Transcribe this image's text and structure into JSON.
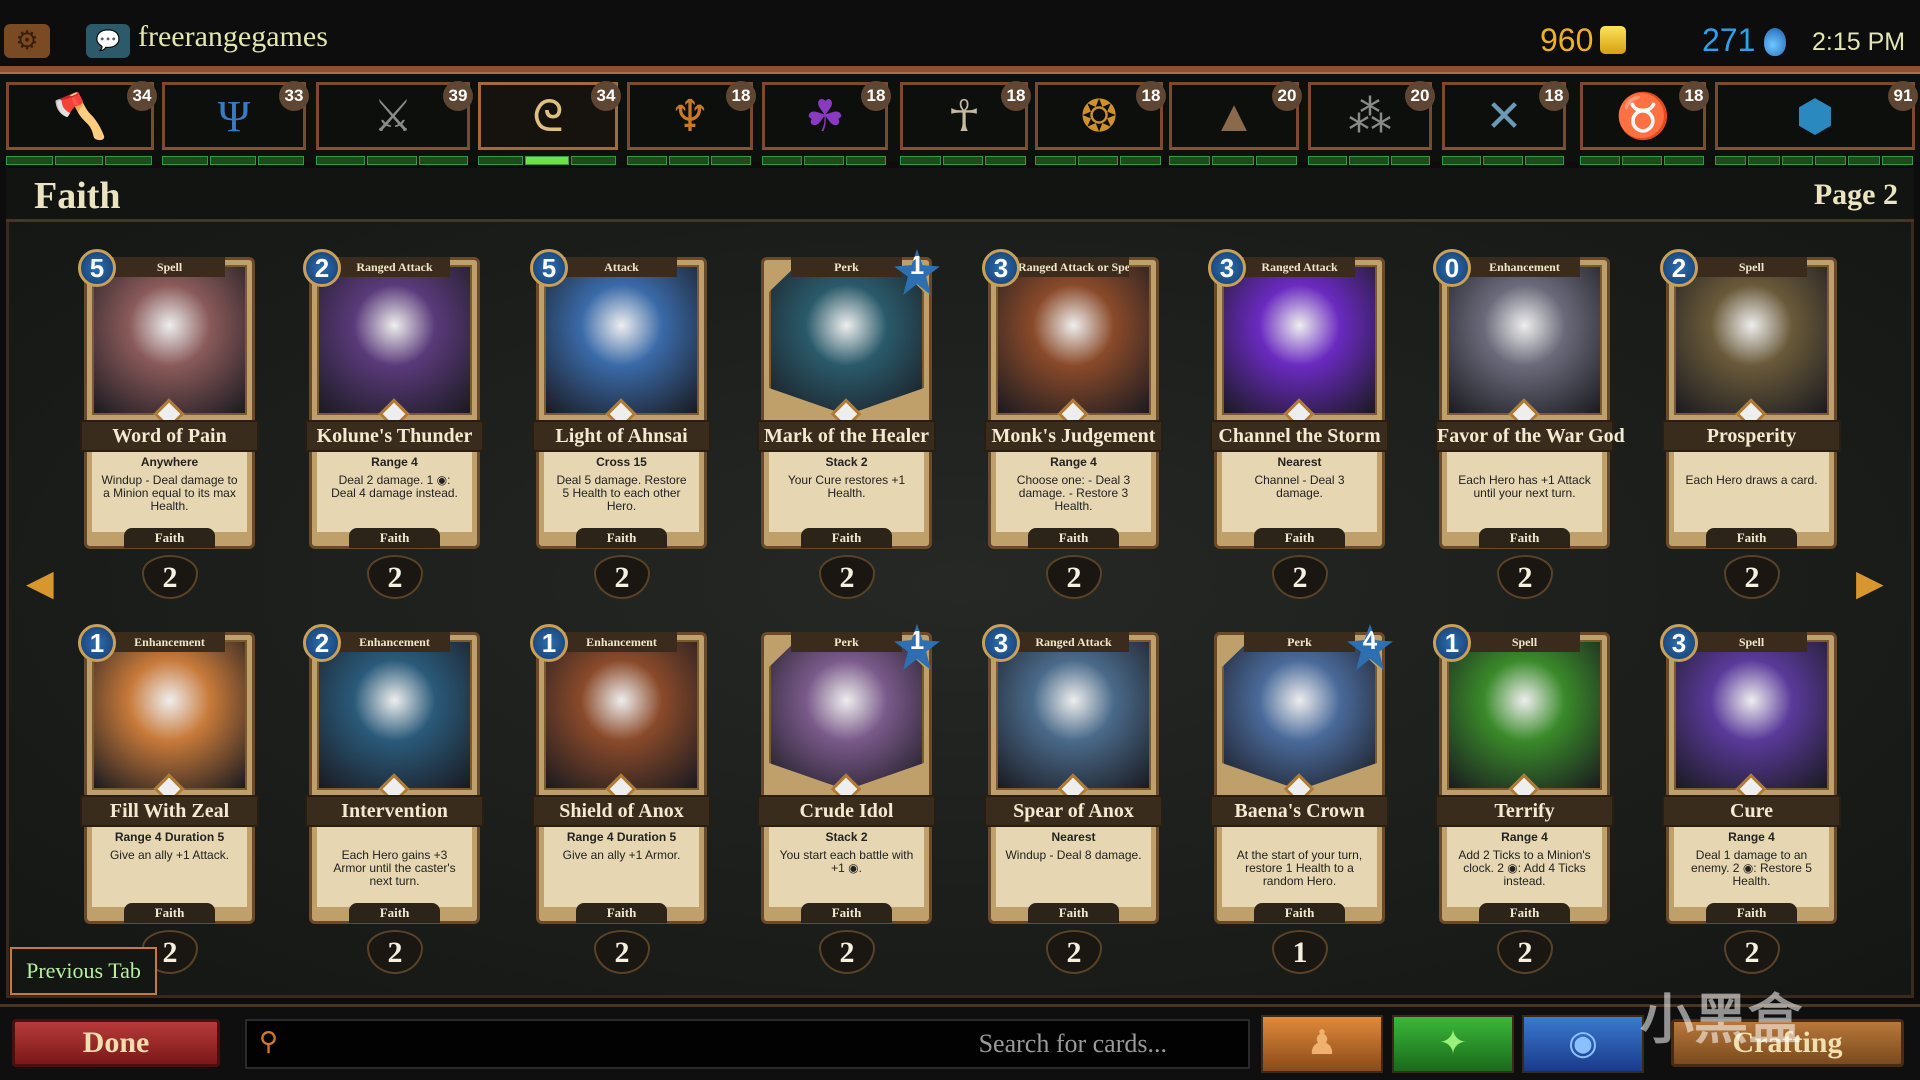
{
  "topbar": {
    "username": "freerangegames",
    "gold": "960",
    "mana": "271",
    "time": "2:15 PM"
  },
  "tabs": [
    {
      "icon": "axe-icon",
      "glyph": "🪓",
      "color": "#c8382a",
      "count": "34"
    },
    {
      "icon": "trident-icon",
      "glyph": "Ψ",
      "color": "#3a7ac0",
      "count": "33"
    },
    {
      "icon": "sword-gear-icon",
      "glyph": "⚔",
      "color": "#8a8a8a",
      "count": "39"
    },
    {
      "icon": "spiral-icon",
      "glyph": "ᘓ",
      "color": "#e0c080",
      "count": "34",
      "selected": true
    },
    {
      "icon": "beetle-icon",
      "glyph": "♆",
      "color": "#c87a2a",
      "count": "18"
    },
    {
      "icon": "triquetra-icon",
      "glyph": "☘",
      "color": "#8a3ac0",
      "count": "18"
    },
    {
      "icon": "ankh-icon",
      "glyph": "☥",
      "color": "#c8b8a0",
      "count": "18"
    },
    {
      "icon": "gems-icon",
      "glyph": "❂",
      "color": "#d0902a",
      "count": "18"
    },
    {
      "icon": "pyramid-eye-icon",
      "glyph": "▲",
      "color": "#8a6a4a",
      "count": "20"
    },
    {
      "icon": "shards-icon",
      "glyph": "⁂",
      "color": "#8a8a8a",
      "count": "20"
    },
    {
      "icon": "blades-icon",
      "glyph": "✕",
      "color": "#6a9ab8",
      "count": "18"
    },
    {
      "icon": "demon-head-icon",
      "glyph": "♉",
      "color": "#c03a2a",
      "count": "18"
    },
    {
      "icon": "cube-icon",
      "glyph": "⬢",
      "color": "#2a8ac0",
      "count": "91"
    }
  ],
  "header": {
    "title": "Faith",
    "page": "Page 2"
  },
  "cards": [
    {
      "name": "Word of Pain",
      "type": "Spell",
      "cost": "5",
      "keyword": "Anywhere",
      "text": "Windup - Deal damage to a Minion equal to its max Health.",
      "faction": "Faith",
      "qty": "2",
      "art": "#8a5a5a"
    },
    {
      "name": "Kolune's Thunder",
      "type": "Ranged Attack",
      "cost": "2",
      "keyword": "Range 4",
      "text": "Deal 2 damage. 1 ◉: Deal 4 damage instead.",
      "faction": "Faith",
      "qty": "2",
      "art": "#5a3a7a"
    },
    {
      "name": "Light of Ahnsai",
      "type": "Attack",
      "cost": "5",
      "keyword": "Cross 15",
      "text": "Deal 5 damage. Restore 5 Health to each other Hero.",
      "faction": "Faith",
      "qty": "2",
      "art": "#3a6aa8"
    },
    {
      "name": "Mark of the Healer",
      "type": "Perk",
      "cost": "1",
      "perk": true,
      "keyword": "Stack 2",
      "text": "Your Cure restores +1 Health.",
      "faction": "Faith",
      "qty": "2",
      "art": "#2a5a6a"
    },
    {
      "name": "Monk's Judgement",
      "type": "Ranged Attack or Spell",
      "cost": "3",
      "keyword": "Range 4",
      "text": "Choose one: - Deal 3 damage. - Restore 3 Health.",
      "faction": "Faith",
      "qty": "2",
      "art": "#8a4a2a"
    },
    {
      "name": "Channel the Storm",
      "type": "Ranged Attack",
      "cost": "3",
      "keyword": "Nearest",
      "text": "Channel - Deal 3 damage.",
      "faction": "Faith",
      "qty": "2",
      "art": "#6a2ac0"
    },
    {
      "name": "Favor of the War God",
      "type": "Enhancement",
      "cost": "0",
      "keyword": "",
      "text": "Each Hero has +1 Attack until your next turn.",
      "faction": "Faith",
      "qty": "2",
      "art": "#6a6a7a"
    },
    {
      "name": "Prosperity",
      "type": "Spell",
      "cost": "2",
      "keyword": "",
      "text": "Each Hero draws a card.",
      "faction": "Faith",
      "qty": "2",
      "art": "#6a5a3a"
    },
    {
      "name": "Fill With Zeal",
      "type": "Enhancement",
      "cost": "1",
      "keyword": "Range 4 Duration 5",
      "text": "Give an ally +1 Attack.",
      "faction": "Faith",
      "qty": "2",
      "art": "#c87a3a"
    },
    {
      "name": "Intervention",
      "type": "Enhancement",
      "cost": "2",
      "keyword": "",
      "text": "Each Hero gains +3 Armor until the caster's next turn.",
      "faction": "Faith",
      "qty": "2",
      "art": "#2a5a7a"
    },
    {
      "name": "Shield of Anox",
      "type": "Enhancement",
      "cost": "1",
      "keyword": "Range 4 Duration 5",
      "text": "Give an ally +1 Armor.",
      "faction": "Faith",
      "qty": "2",
      "art": "#8a4a2a"
    },
    {
      "name": "Crude Idol",
      "type": "Perk",
      "cost": "1",
      "perk": true,
      "keyword": "Stack 2",
      "text": "You start each battle with +1 ◉.",
      "faction": "Faith",
      "qty": "2",
      "art": "#7a5a8a"
    },
    {
      "name": "Spear of Anox",
      "type": "Ranged Attack",
      "cost": "3",
      "keyword": "Nearest",
      "text": "Windup - Deal 8 damage.",
      "faction": "Faith",
      "qty": "2",
      "art": "#4a6a8a"
    },
    {
      "name": "Baena's Crown",
      "type": "Perk",
      "cost": "4",
      "perk": true,
      "keyword": "",
      "text": "At the start of your turn, restore 1 Health to a random Hero.",
      "faction": "Faith",
      "qty": "1",
      "art": "#4a6a9a"
    },
    {
      "name": "Terrify",
      "type": "Spell",
      "cost": "1",
      "keyword": "Range 4",
      "text": "Add 2 Ticks to a Minion's clock. 2 ◉: Add 4 Ticks instead.",
      "faction": "Faith",
      "qty": "2",
      "art": "#3a8a2a"
    },
    {
      "name": "Cure",
      "type": "Spell",
      "cost": "3",
      "keyword": "Range 4",
      "text": "Deal 1 damage to an enemy. 2 ◉: Restore 5 Health.",
      "faction": "Faith",
      "qty": "2",
      "art": "#5a3a9a"
    }
  ],
  "nav": {
    "prev_arrow": "◀",
    "next_arrow": "▶",
    "previous_tab": "Previous Tab"
  },
  "bottom": {
    "done": "Done",
    "search_placeholder": "Search for cards...",
    "crafting": "Crafting",
    "filters": [
      {
        "icon": "hero-figure-icon",
        "glyph": "♟",
        "color": "#d07a2a"
      },
      {
        "icon": "stars-icon",
        "glyph": "✦",
        "color": "#2a9a2a"
      },
      {
        "icon": "eye-icon",
        "glyph": "◉",
        "color": "#2a5ac0"
      }
    ]
  },
  "watermark": "小黑盒"
}
